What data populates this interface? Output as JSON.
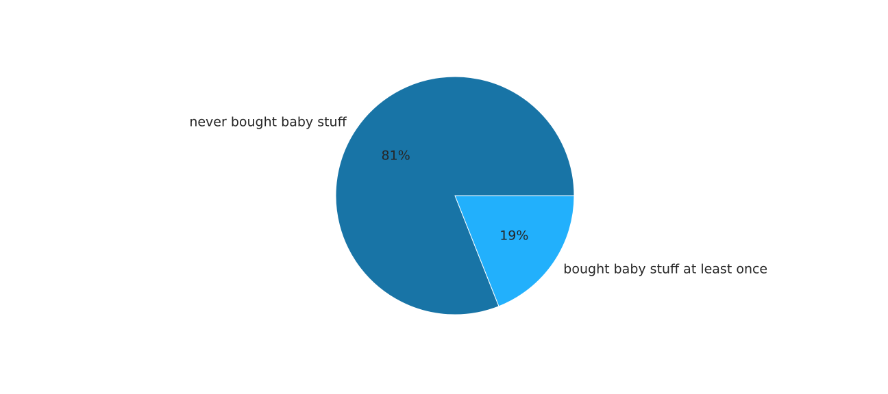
{
  "chart_data": {
    "type": "pie",
    "title": "",
    "categories": [
      "never bought baby stuff",
      "bought baby stuff at least once"
    ],
    "values": [
      81,
      19
    ],
    "value_labels": [
      "81%",
      "19%"
    ],
    "colors": [
      "#1874a6",
      "#22b0fc"
    ],
    "start_angle_deg": 0,
    "direction": "counterclockwise",
    "legend": "none"
  }
}
